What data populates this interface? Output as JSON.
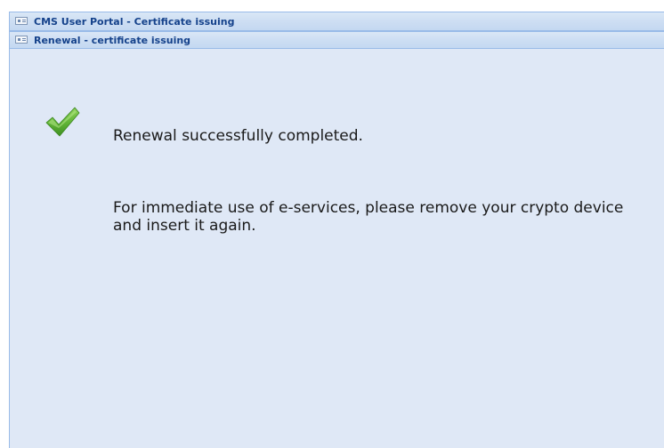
{
  "outer_window": {
    "title": "CMS User Portal - Certificate issuing"
  },
  "inner_window": {
    "title": "Renewal - certificate issuing"
  },
  "message": {
    "success_text": "Renewal successfully completed.",
    "instruction_text": "For immediate use of e-services, please remove your crypto device and insert it again."
  },
  "icons": {
    "window_icon": "card-icon",
    "status_icon": "checkmark-icon"
  },
  "colors": {
    "panel_background": "#dfe8f6",
    "header_text": "#15428b",
    "panel_border": "#99bbe8",
    "checkmark_green": "#5fb336"
  }
}
